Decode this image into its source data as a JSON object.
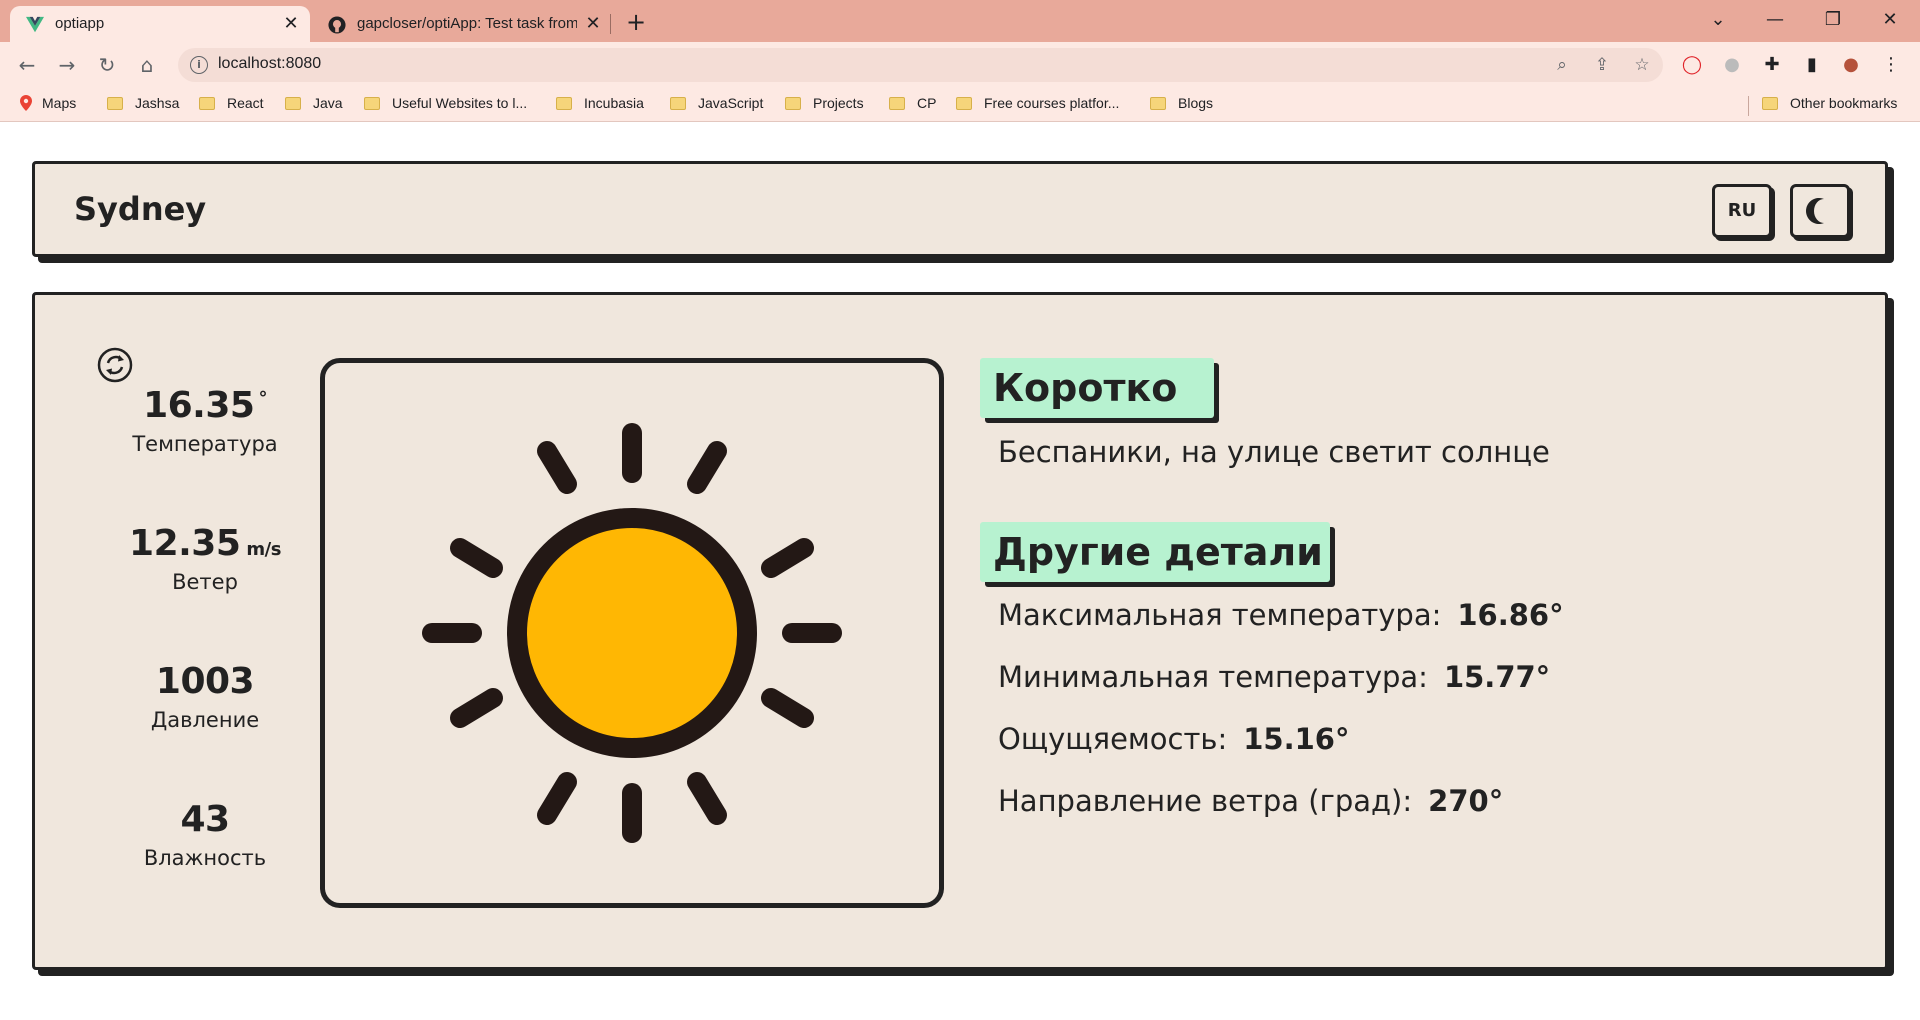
{
  "browser": {
    "tabs": [
      {
        "title": "optiapp",
        "icon": "vue-icon",
        "active": true
      },
      {
        "title": "gapcloser/optiApp: Test task from",
        "icon": "github-icon",
        "active": false
      }
    ],
    "url": "localhost:8080",
    "bookmarks": [
      {
        "label": "Maps",
        "icon": "maps-icon"
      },
      {
        "label": "Jashsa",
        "icon": "folder-icon"
      },
      {
        "label": "React",
        "icon": "folder-icon"
      },
      {
        "label": "Java",
        "icon": "folder-icon"
      },
      {
        "label": "Useful Websites to l...",
        "icon": "folder-icon"
      },
      {
        "label": "Incubasia",
        "icon": "folder-icon"
      },
      {
        "label": "JavaScript",
        "icon": "folder-icon"
      },
      {
        "label": "Projects",
        "icon": "folder-icon"
      },
      {
        "label": "CP",
        "icon": "folder-icon"
      },
      {
        "label": "Free courses platfor...",
        "icon": "folder-icon"
      },
      {
        "label": "Blogs",
        "icon": "folder-icon"
      }
    ],
    "other_bookmarks": "Other bookmarks",
    "colors": {
      "chrome": "#e8a99a",
      "toolbar": "#fde9e3"
    }
  },
  "app": {
    "city": "Sydney",
    "lang_button": "RU",
    "theme_icon": "moon-icon",
    "stats": {
      "temperature": {
        "value": "16.35",
        "unit": "°",
        "label": "Температура"
      },
      "wind": {
        "value": "12.35",
        "unit": "m/s",
        "label": "Ветер"
      },
      "pressure": {
        "value": "1003",
        "label": "Давление"
      },
      "humidity": {
        "value": "43",
        "label": "Влажность"
      }
    },
    "weather_icon": "sun-icon",
    "short_title": "Коротко",
    "short_text": "Беспаники, на улице светит солнце",
    "details_title": "Другие детали",
    "details": [
      {
        "label": "Максимальная температура:",
        "value": "16.86°"
      },
      {
        "label": "Минимальная температура:",
        "value": "15.77°"
      },
      {
        "label": "Ощущяемость:",
        "value": "15.16°"
      },
      {
        "label": "Направление ветра (град):",
        "value": "270°"
      }
    ],
    "colors": {
      "card": "#f0e7dd",
      "badge": "#b7f2d0",
      "sun": "#ffb703",
      "ink": "#222222"
    }
  }
}
